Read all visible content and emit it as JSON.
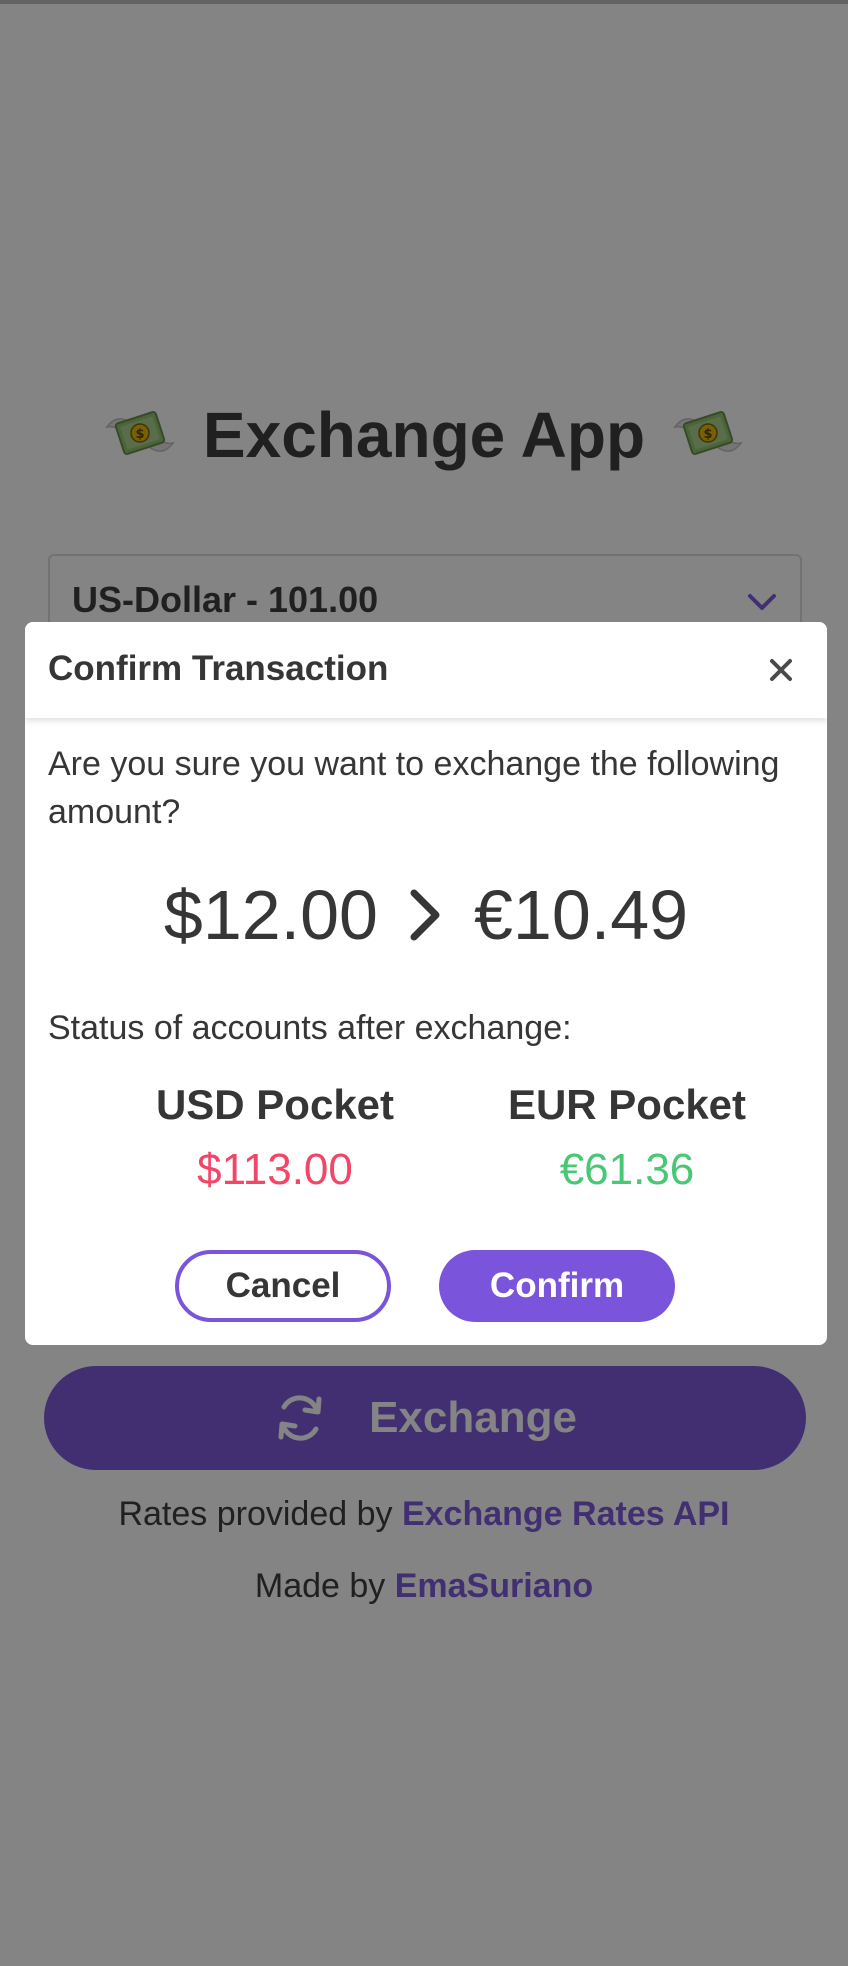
{
  "app": {
    "title": "Exchange App",
    "title_icon": "money-with-wings-icon"
  },
  "currency_select": {
    "selected": "US-Dollar - 101.00",
    "icon": "chevron-down-icon"
  },
  "exchange_button": {
    "label": "Exchange",
    "icon": "sync-icon"
  },
  "footer": {
    "rates_prefix": "Rates provided by",
    "rates_link": "Exchange Rates API",
    "made_prefix": "Made by",
    "made_link": "EmaSuriano"
  },
  "modal": {
    "title": "Confirm Transaction",
    "question": "Are you sure you want to exchange the following amount?",
    "from_amount": "$12.00",
    "to_amount": "€10.49",
    "status_label": "Status of accounts after exchange:",
    "pockets": [
      {
        "name": "USD Pocket",
        "value": "$113.00",
        "color": "#f14668"
      },
      {
        "name": "EUR Pocket",
        "value": "€61.36",
        "color": "#48c774"
      }
    ],
    "cancel_label": "Cancel",
    "confirm_label": "Confirm"
  },
  "colors": {
    "accent": "#7a55db",
    "text": "#363636",
    "negative": "#f14668",
    "positive": "#48c774",
    "overlay": "rgba(10,10,10,0.5)"
  }
}
